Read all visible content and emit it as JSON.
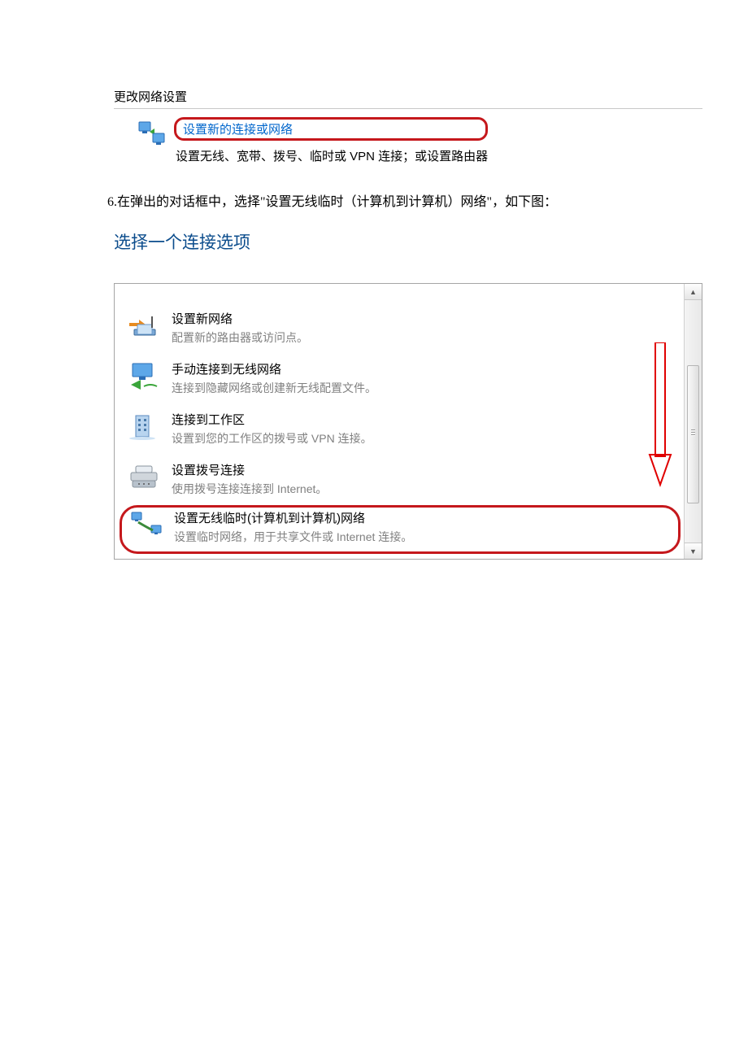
{
  "section1": {
    "header": "更改网络设置",
    "link_title": "设置新的连接或网络",
    "description": "设置无线、宽带、拨号、临时或 VPN 连接；或设置路由器"
  },
  "caption": "6.在弹出的对话框中，选择\"设置无线临时（计算机到计算机）网络\"，如下图：",
  "dialog_title": "选择一个连接选项",
  "options": [
    {
      "title": "设置新网络",
      "desc": "配置新的路由器或访问点。"
    },
    {
      "title": "手动连接到无线网络",
      "desc": "连接到隐藏网络或创建新无线配置文件。"
    },
    {
      "title": "连接到工作区",
      "desc": "设置到您的工作区的拨号或 VPN 连接。"
    },
    {
      "title": "设置拨号连接",
      "desc": "使用拨号连接连接到 Internet。"
    },
    {
      "title": "设置无线临时(计算机到计算机)网络",
      "desc": "设置临时网络，用于共享文件或 Internet 连接。"
    }
  ]
}
